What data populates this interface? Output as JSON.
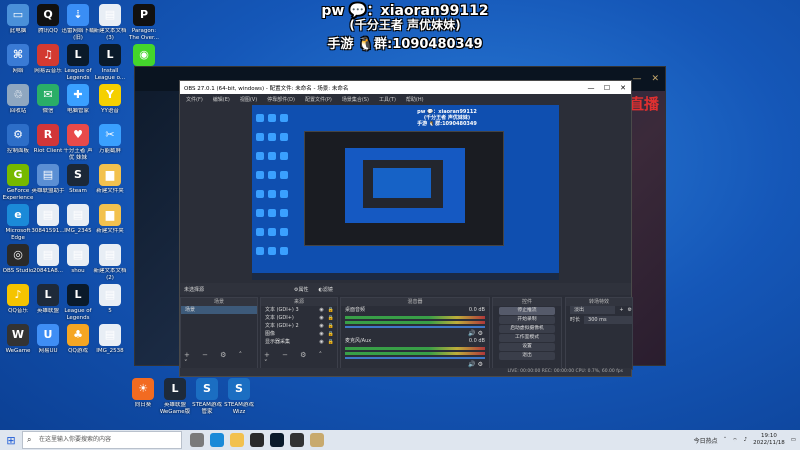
{
  "overlay": {
    "line1": "pw 💬：xiaoran99112",
    "line2": "(千分王者 声优妹妹)",
    "line3": "手游 🐧群:1090480349"
  },
  "desktop_icons": [
    {
      "label": "此电脑",
      "color": "#4a90d9",
      "glyph": "▭"
    },
    {
      "label": "网络",
      "color": "#3a7bd5",
      "glyph": "⌘"
    },
    {
      "label": "回收站",
      "color": "#8fa7c0",
      "glyph": "♲"
    },
    {
      "label": "控制面板",
      "color": "#2d6ec8",
      "glyph": "⚙"
    },
    {
      "label": "GeForce Experience",
      "color": "#76b900",
      "glyph": "G"
    },
    {
      "label": "Microsoft Edge",
      "color": "#1b8ad8",
      "glyph": "e"
    },
    {
      "label": "OBS Studio",
      "color": "#2a2a2a",
      "glyph": "◎"
    },
    {
      "label": "QQ音乐",
      "color": "#f5c400",
      "glyph": "♪"
    },
    {
      "label": "WeGame",
      "color": "#333333",
      "glyph": "W"
    },
    {
      "label": "网易UU",
      "color": "#3f8ef5",
      "glyph": "U"
    },
    {
      "label": "腾讯QQ",
      "color": "#111111",
      "glyph": "Q"
    },
    {
      "label": "网易云音乐",
      "color": "#d33a31",
      "glyph": "♫"
    },
    {
      "label": "微信",
      "color": "#2aae67",
      "glyph": "✉"
    },
    {
      "label": "Riot Client",
      "color": "#d13639",
      "glyph": "R"
    },
    {
      "label": "英雄联盟助手",
      "color": "#5b8fd4",
      "glyph": "▤"
    },
    {
      "label": "30841591...",
      "color": "#e8eef5",
      "glyph": "▤"
    },
    {
      "label": "20841A8...",
      "color": "#e8eef5",
      "glyph": "▤"
    },
    {
      "label": "英雄联盟",
      "color": "#1e2a3a",
      "glyph": "L"
    },
    {
      "label": "迅雷网络下载(旧)",
      "color": "#3a8ef5",
      "glyph": "⇣"
    },
    {
      "label": "League of Legends",
      "color": "#0a1a2a",
      "glyph": "L"
    },
    {
      "label": "电脑管家",
      "color": "#3aa0ff",
      "glyph": "✚"
    },
    {
      "label": "千分王者 声优 妹妹",
      "color": "#e84a4a",
      "glyph": "♥"
    },
    {
      "label": "Steam",
      "color": "#1b2838",
      "glyph": "S"
    },
    {
      "label": "IMG_2345",
      "color": "#e8eef5",
      "glyph": "▤"
    },
    {
      "label": "shou",
      "color": "#e8eef5",
      "glyph": "▤"
    },
    {
      "label": "League of Legends",
      "color": "#0a1a2a",
      "glyph": "L"
    },
    {
      "label": "QQ游戏",
      "color": "#f5a623",
      "glyph": "♣"
    },
    {
      "label": "新建文本文档 (3)",
      "color": "#e8eef5",
      "glyph": "▤"
    },
    {
      "label": "Install League o...",
      "color": "#0a1a2a",
      "glyph": "L"
    },
    {
      "label": "YY语音",
      "color": "#f5d000",
      "glyph": "Y"
    },
    {
      "label": "万能截屏",
      "color": "#3aa0ff",
      "glyph": "✂"
    },
    {
      "label": "新建文件夹",
      "color": "#f2c14e",
      "glyph": "▆"
    },
    {
      "label": "新建文件夹",
      "color": "#f2c14e",
      "glyph": "▆"
    },
    {
      "label": "新建文本文档 (2)",
      "color": "#e8eef5",
      "glyph": "▤"
    },
    {
      "label": "5",
      "color": "#e8eef5",
      "glyph": "▤"
    },
    {
      "label": "IMG_2538",
      "color": "#e8eef5",
      "glyph": "▤"
    },
    {
      "label": "Paragon: The Over...",
      "color": "#111111",
      "glyph": "P"
    },
    {
      "label": "Razer Cortex",
      "color": "#44d62c",
      "glyph": "◉"
    },
    {
      "label": "向日葵",
      "color": "#f26b21",
      "glyph": "☀"
    },
    {
      "label": "英雄联盟 WeGame版",
      "color": "#1e2a3a",
      "glyph": "L"
    },
    {
      "label": "STEAM游戏管家",
      "color": "#1b6ec2",
      "glyph": "S"
    },
    {
      "label": "STEAM游戏 Wizz",
      "color": "#1b6ec2",
      "glyph": "S"
    }
  ],
  "lol_window": {
    "live_text": "直播"
  },
  "obs": {
    "title": "OBS 27.0.1 (64-bit, windows) - 配置文件: 未命名 - 场景: 未命名",
    "menu": [
      "文件(F)",
      "编辑(E)",
      "视图(V)",
      "停靠部件(D)",
      "配置文件(P)",
      "场景集合(S)",
      "工具(T)",
      "帮助(H)"
    ],
    "toolbar_label": "未选择源",
    "toolbar_props": "⚙属性",
    "toolbar_filters": "◐滤镜",
    "docks": {
      "scenes_header": "场景",
      "scenes": [
        "场景"
      ],
      "sources_header": "来源",
      "sources": [
        "文本 (GDI+) 3",
        "文本 (GDI+)",
        "文本 (GDI+) 2",
        "图像",
        "显示器采集"
      ],
      "mixer_header": "混音器",
      "mixer": [
        {
          "name": "桌面音频",
          "level": "0.0 dB"
        },
        {
          "name": "麦克风/Aux",
          "level": "0.0 dB"
        }
      ],
      "transitions_header": "转场",
      "controls_header": "控件",
      "controls": [
        "停止推流",
        "开始录制",
        "启动虚拟摄像机",
        "工作室模式",
        "设置",
        "退出"
      ],
      "trans_header": "转场特效",
      "trans_type": "淡出",
      "trans_duration_label": "时长",
      "trans_duration": "300 ms"
    },
    "status": "LIVE: 00:00:00    REC: 00:00:00    CPU: 0.7%, 60.00 fps"
  },
  "taskbar": {
    "search_placeholder": "在这里输入你要搜索的内容",
    "hot_label": "今日热点",
    "time": "19:10",
    "date": "2022/11/18"
  }
}
